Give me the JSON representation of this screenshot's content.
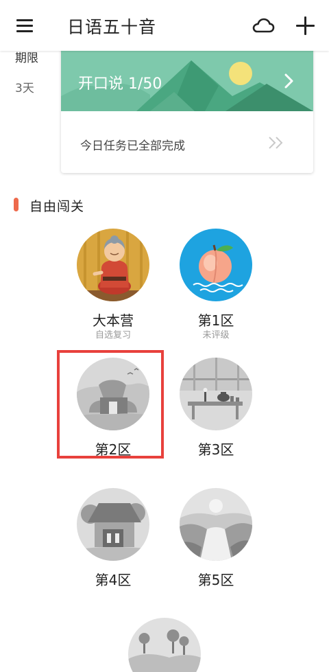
{
  "appbar": {
    "title": "日语五十音",
    "menu_icon": "menu-icon",
    "cloud_icon": "cloud-icon",
    "add_icon": "plus-icon"
  },
  "deadline": {
    "label": "期限",
    "value": "3天"
  },
  "task_card": {
    "banner_text": "开口说 1/50",
    "status_text": "今日任务已全部完成",
    "banner_color": "#7ec9ac",
    "arrow_icon": "chevron-right-icon",
    "status_arrow_icon": "double-chevron-right-icon"
  },
  "section": {
    "title": "自由闯关",
    "accent_color": "#ee6a4c"
  },
  "levels": [
    {
      "name": "大本营",
      "sub": "自选复习"
    },
    {
      "name": "第1区",
      "sub": "未评级"
    },
    {
      "name": "第2区",
      "sub": ""
    },
    {
      "name": "第3区",
      "sub": ""
    },
    {
      "name": "第4区",
      "sub": ""
    },
    {
      "name": "第5区",
      "sub": ""
    },
    {
      "name": "",
      "sub": ""
    }
  ],
  "highlight_color": "#e8413c"
}
